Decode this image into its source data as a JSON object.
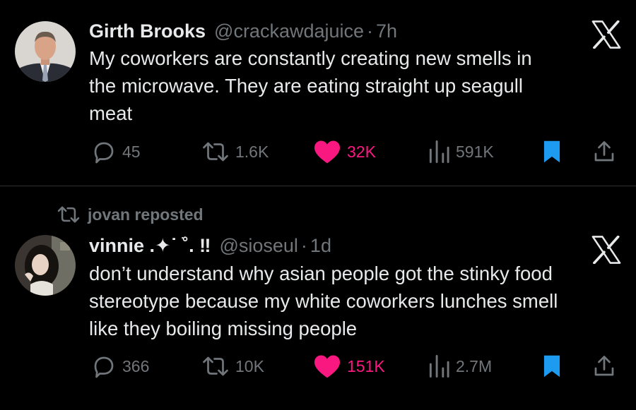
{
  "tweets": [
    {
      "author_name": "Girth Brooks",
      "handle": "@crackawdajuice",
      "separator": "·",
      "time": "7h",
      "text_lines": [
        "My coworkers are constantly creating new smells in",
        "the microwave. They are eating straight up seagull",
        "meat"
      ],
      "replies": "45",
      "reposts": "1.6K",
      "likes": "32K",
      "views": "591K",
      "liked": true,
      "bookmarked": true
    },
    {
      "repost_context": "jovan reposted",
      "author_name": "vinnie .✦˙ ֹ˚. ‼",
      "handle": "@sioseul",
      "separator": "·",
      "time": "1d",
      "text_lines": [
        "don’t understand why asian people got the stinky food",
        "stereotype because my white coworkers lunches smell",
        "like they boiling missing people"
      ],
      "replies": "366",
      "reposts": "10K",
      "likes": "151K",
      "views": "2.7M",
      "liked": true,
      "bookmarked": true
    }
  ],
  "icons": {
    "platform_logo": "x-logo-icon",
    "reply": "speech-bubble-icon",
    "repost": "repost-arrows-icon",
    "like": "heart-icon",
    "views": "bar-chart-icon",
    "bookmark": "bookmark-icon",
    "share": "share-icon"
  },
  "colors": {
    "background": "#000000",
    "text": "#e7e9ea",
    "muted": "#71767b",
    "like": "#f91880",
    "bookmark": "#1d9bf0",
    "divider": "#2f3336"
  }
}
